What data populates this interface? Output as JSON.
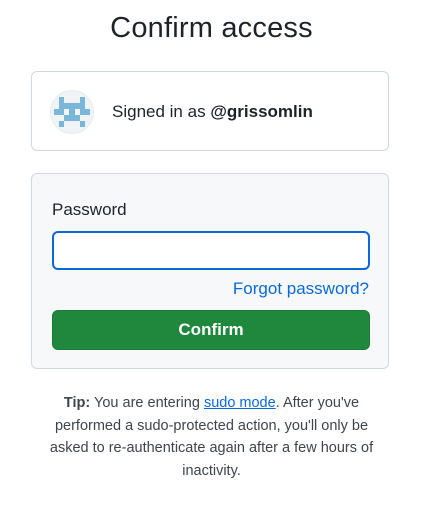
{
  "page": {
    "title": "Confirm access"
  },
  "account": {
    "signed_in_prefix": "Signed in as",
    "username": "@grissomlin",
    "avatar_icon": "identicon-avatar"
  },
  "form": {
    "password_label": "Password",
    "password_value": "",
    "forgot_link": "Forgot password?",
    "confirm_button": "Confirm"
  },
  "tip": {
    "label": "Tip:",
    "text_before_link": "You are entering",
    "link_text": "sudo mode",
    "text_after_link": ". After you've performed a sudo-protected action, you'll only be asked to re-authenticate again after a few hours of inactivity."
  },
  "colors": {
    "accent": "#0969da",
    "confirm_green": "#1f883d",
    "identicon": "#7ab6d9",
    "panel_bg": "#f6f8fa",
    "border": "#d1d9e0"
  }
}
